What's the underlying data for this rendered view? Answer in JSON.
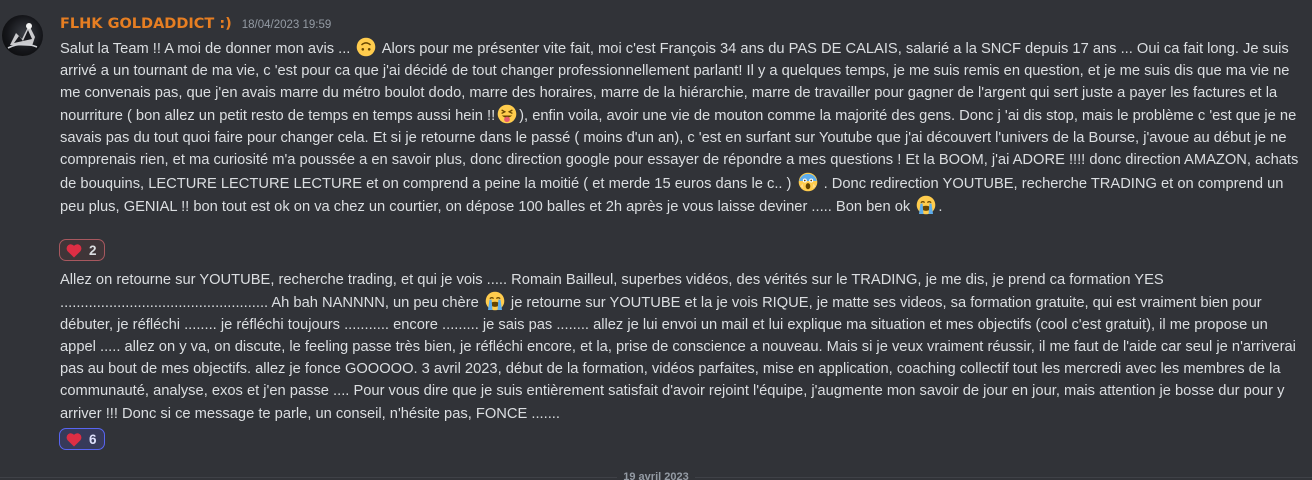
{
  "message": {
    "author": "FLHK GOLDADDICT :)",
    "timestamp": "18/04/2023 19:59",
    "author_color": "#e67e22",
    "paragraph1": {
      "text_a": "Salut la Team !! A moi de donner mon avis ... ",
      "emoji_a": "upside-down-face-emoji",
      "text_b": "   Alors pour me présenter vite fait, moi c'est François 34 ans du PAS DE CALAIS, salarié a la SNCF depuis 17 ans ... Oui ca fait long. Je suis arrivé a un tournant de ma vie, c 'est pour ca que j'ai décidé de tout changer professionnellement parlant! Il y a quelques temps, je me suis remis en question, et je me suis dis que ma vie ne me convenais pas, que j'en avais marre du métro boulot dodo, marre des horaires, marre de la hiérarchie, marre de travailler pour gagner de l'argent qui sert juste a payer les factures et la nourriture ( bon allez un petit resto de temps en temps aussi hein !!",
      "emoji_b": "squinting-tongue-emoji",
      "text_c": "), enfin voila, avoir une vie de mouton comme la majorité des gens. Donc j 'ai dis stop, mais le problème c 'est que je ne savais pas du tout quoi faire pour changer cela. Et si je retourne dans le passé ( moins d'un an), c 'est en surfant sur Youtube que j'ai découvert l'univers de la Bourse, j'avoue au début je ne comprenais rien, et ma curiosité m'a poussée a en savoir plus, donc direction google pour essayer de répondre a mes questions ! Et la BOOM, j'ai ADORE !!!! donc direction AMAZON, achats de bouquins, LECTURE LECTURE LECTURE et on comprend a peine la moitié ( et merde 15 euros dans le c.. ) ",
      "emoji_c": "screaming-face-emoji",
      "text_d": " . Donc redirection YOUTUBE, recherche  TRADING et on comprend un peu plus, GENIAL !! bon tout est ok on va chez un courtier, on dépose 100 balles et 2h après je vous laisse deviner ..... Bon ben ok ",
      "emoji_d": "loudly-crying-emoji",
      "text_e": "."
    },
    "reaction1": {
      "emoji": "red-heart",
      "count": "2"
    },
    "paragraph2": {
      "text_a": "Allez on retourne sur YOUTUBE, recherche trading, et qui je vois ..... Romain Bailleul, superbes vidéos, des vérités sur le TRADING, je me dis, je prend ca formation YES ................................................... Ah bah NANNNN, un peu chère ",
      "emoji_a": "loudly-crying-emoji",
      "text_b": " je retourne sur YOUTUBE et la je vois RIQUE, je matte ses videos, sa formation gratuite, qui est vraiment bien pour débuter, je réfléchi ........ je réfléchi toujours ........... encore ......... je sais pas ........ allez je lui envoi un mail et lui explique ma situation et mes objectifs (cool c'est gratuit), il me propose un appel ..... allez on y va, on discute, le feeling passe très bien, je réfléchi encore, et la, prise de conscience a nouveau. Mais si  je veux vraiment réussir, il me faut de l'aide car seul je n'arriverai pas au bout de mes objectifs. allez je fonce GOOOOO.  3 avril  2023, début de la formation, vidéos parfaites, mise en application, coaching collectif tout les mercredi avec les membres de la communauté,  analyse, exos et j'en passe .... Pour vous dire que je suis entièrement satisfait d'avoir rejoint l'équipe, j'augmente mon savoir de jour en jour, mais attention je bosse dur pour y arriver !!! Donc si ce message te parle, un conseil, n'hésite pas, FONCE ......."
    },
    "reaction2": {
      "emoji": "red-heart",
      "count": "6"
    }
  },
  "date_divider": "19 avril 2023"
}
